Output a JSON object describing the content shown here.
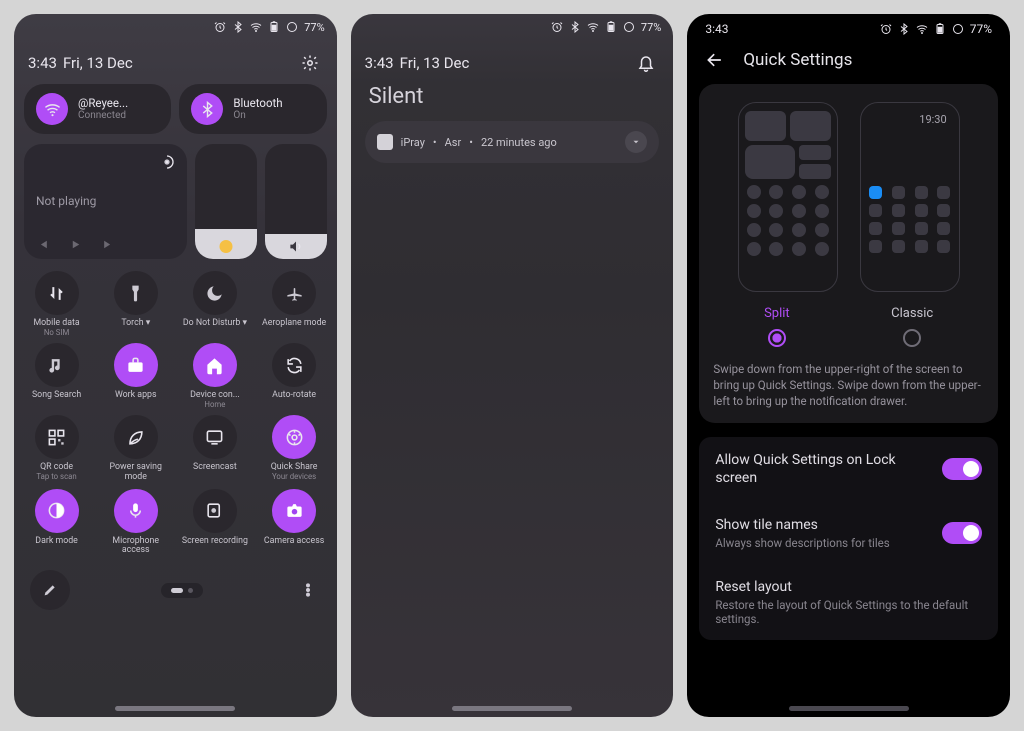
{
  "status": {
    "battery": "77%",
    "time": "3:43",
    "date": "Fri, 13 Dec"
  },
  "panel1": {
    "wifi": {
      "name": "@Reyee...",
      "sub": "Connected"
    },
    "bt": {
      "name": "Bluetooth",
      "sub": "On"
    },
    "media": {
      "title": "Not playing"
    },
    "tiles": [
      {
        "label": "Mobile data",
        "sub": "No SIM",
        "icon": "arrows-updown",
        "on": false
      },
      {
        "label": "Torch ▾",
        "icon": "flashlight",
        "on": false
      },
      {
        "label": "Do Not Disturb ▾",
        "icon": "moon",
        "on": false
      },
      {
        "label": "Aeroplane mode",
        "icon": "plane",
        "on": false
      },
      {
        "label": "Song Search",
        "icon": "note",
        "on": false
      },
      {
        "label": "Work apps",
        "icon": "briefcase",
        "on": true
      },
      {
        "label": "Device con...",
        "sub": "Home",
        "icon": "home",
        "on": true
      },
      {
        "label": "Auto-rotate",
        "icon": "rotate",
        "on": false
      },
      {
        "label": "QR code",
        "sub": "Tap to scan",
        "icon": "qr",
        "on": false
      },
      {
        "label": "Power saving mode",
        "icon": "leaf",
        "on": false
      },
      {
        "label": "Screencast",
        "icon": "cast",
        "on": false
      },
      {
        "label": "Quick Share",
        "sub": "Your devices",
        "icon": "share",
        "on": true
      },
      {
        "label": "Dark mode",
        "icon": "contrast",
        "on": true
      },
      {
        "label": "Microphone access",
        "icon": "mic",
        "on": true
      },
      {
        "label": "Screen recording",
        "icon": "record",
        "on": false
      },
      {
        "label": "Camera access",
        "icon": "camera",
        "on": true
      }
    ]
  },
  "panel2": {
    "heading": "Silent",
    "notif": {
      "app": "iPray",
      "subject": "Asr",
      "time": "22 minutes ago"
    }
  },
  "panel3": {
    "title": "Quick Settings",
    "preview_time": "19:30",
    "options": {
      "split": "Split",
      "classic": "Classic",
      "selected": "split"
    },
    "description": "Swipe down from the upper-right of the screen to bring up Quick Settings. Swipe down from the upper-left to bring up the notification drawer.",
    "rows": [
      {
        "title": "Allow Quick Settings on Lock screen",
        "toggle": true
      },
      {
        "title": "Show tile names",
        "sub": "Always show descriptions for tiles",
        "toggle": true
      },
      {
        "title": "Reset layout",
        "sub": "Restore the layout of Quick Settings to the default settings."
      }
    ]
  }
}
